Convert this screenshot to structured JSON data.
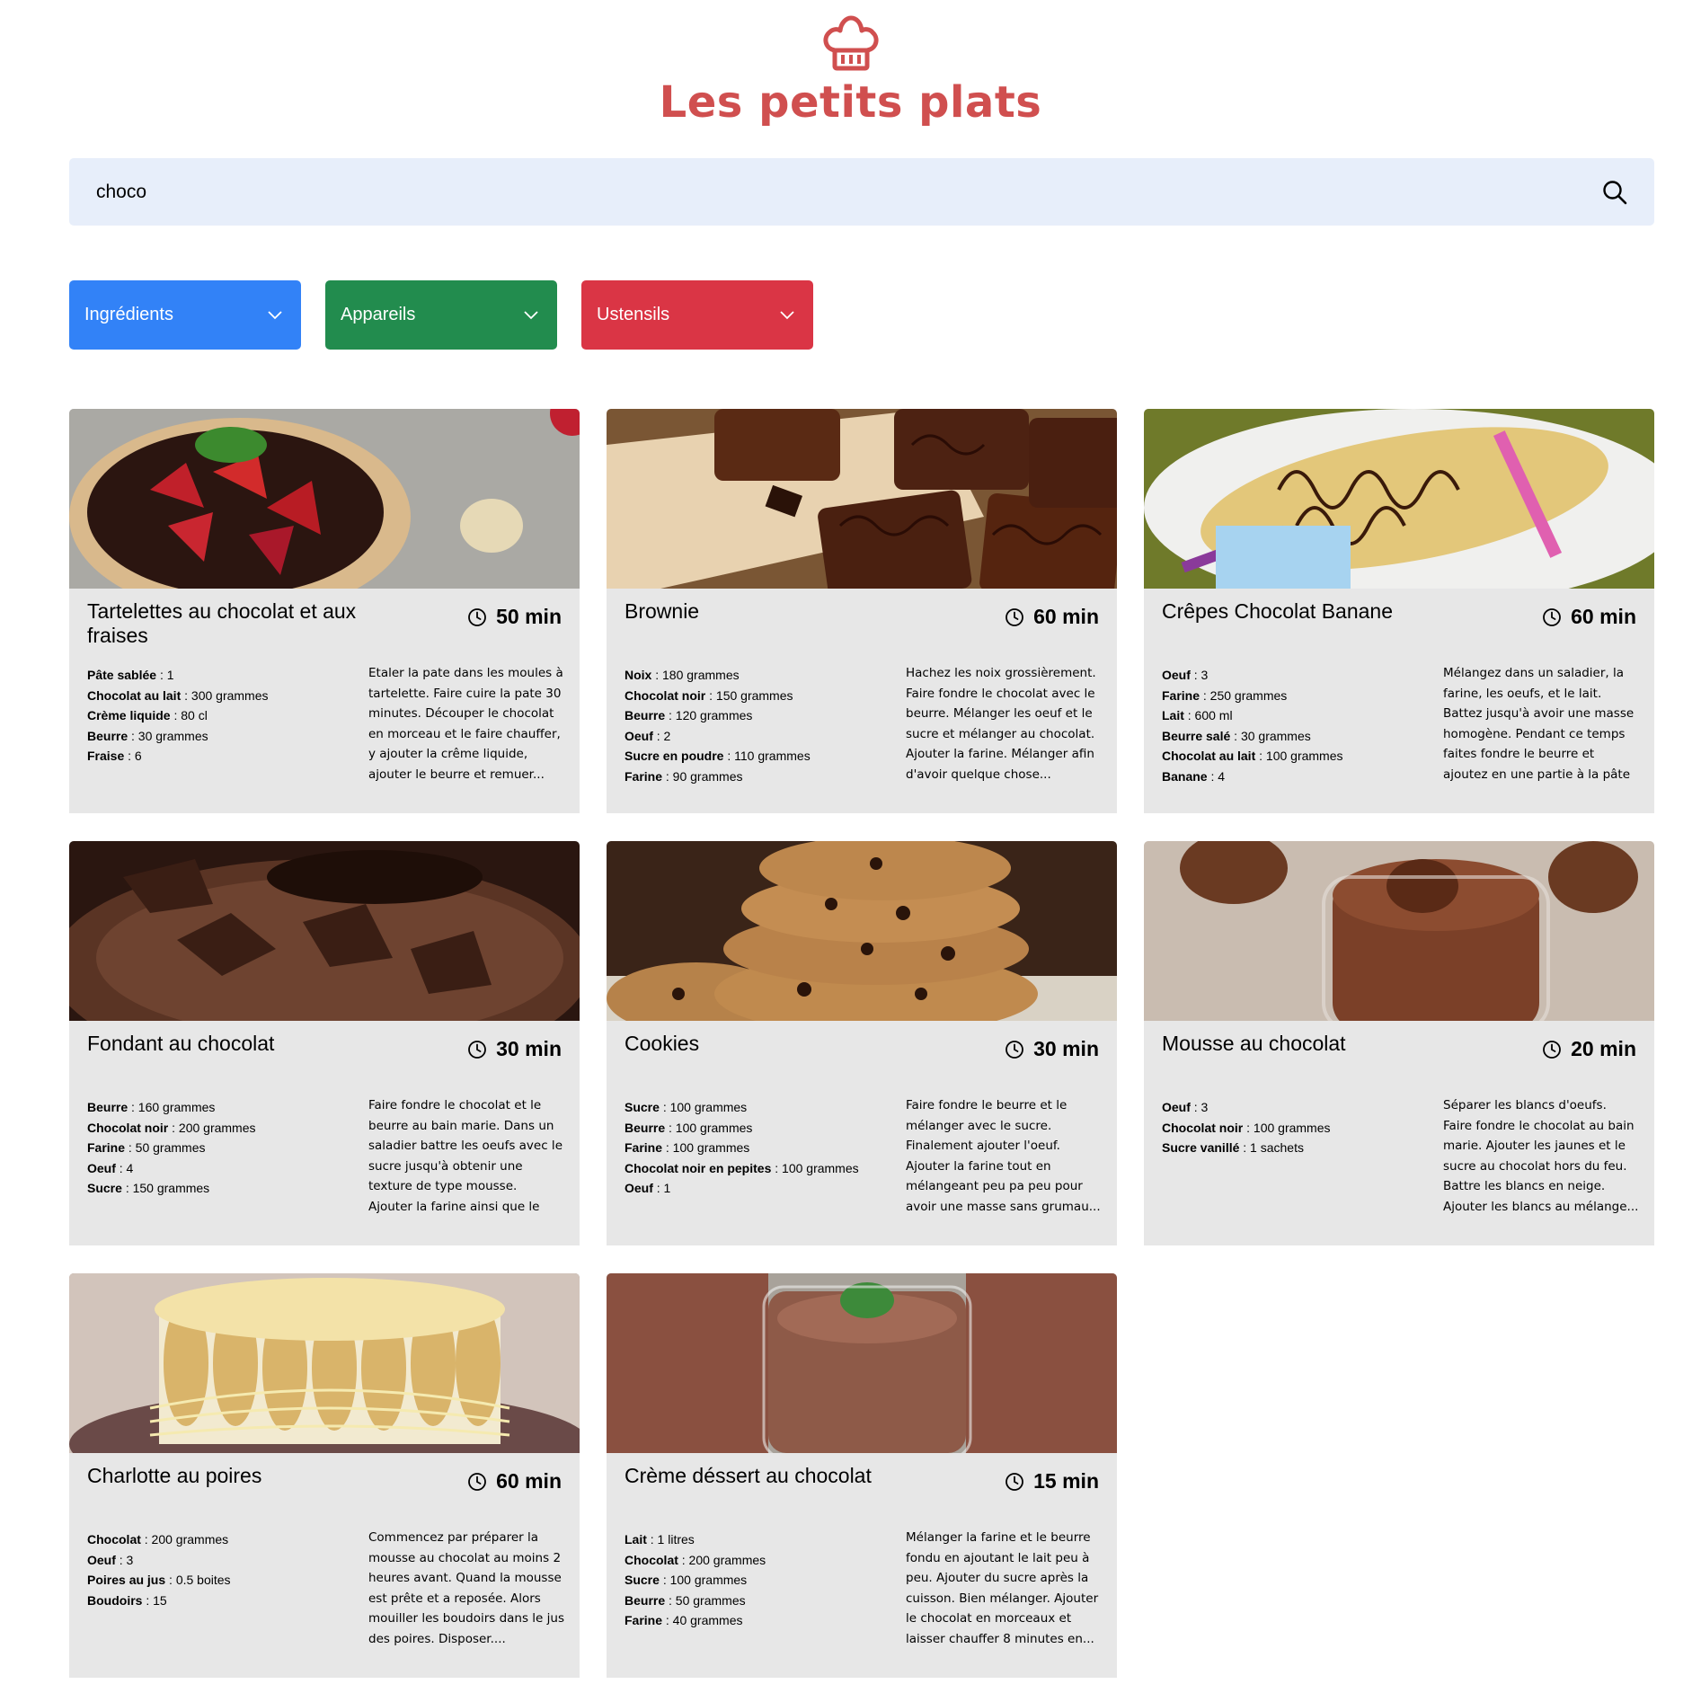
{
  "header": {
    "title": "Les petits plats",
    "logo_icon": "chef-hat-icon",
    "brand_color": "#D04F4F"
  },
  "search": {
    "value": "choco",
    "icon": "search-icon"
  },
  "filters": [
    {
      "label": "Ingrédients",
      "color": "#3282F7",
      "icon": "chevron-down-icon"
    },
    {
      "label": "Appareils",
      "color": "#228C4E",
      "icon": "chevron-down-icon"
    },
    {
      "label": "Ustensils",
      "color": "#DA3545",
      "icon": "chevron-down-icon"
    }
  ],
  "recipes": [
    {
      "name": "Tartelettes au chocolat et aux fraises",
      "time": "50 min",
      "image": "chocolate-strawberry-tart",
      "ingredients": [
        {
          "name": "Pâte sablée",
          "qty": ": 1"
        },
        {
          "name": "Chocolat au lait",
          "qty": ": 300 grammes"
        },
        {
          "name": "Crème liquide",
          "qty": ": 80 cl"
        },
        {
          "name": "Beurre",
          "qty": ": 30 grammes"
        },
        {
          "name": "Fraise",
          "qty": ": 6"
        }
      ],
      "description": "Etaler la pate dans les moules à tartelette. Faire cuire la pate 30 minutes. Découper le chocolat en morceau et le faire chauffer, y ajouter la crême liquide, ajouter le beurre et remuer..."
    },
    {
      "name": "Brownie",
      "time": "60 min",
      "image": "brownie",
      "ingredients": [
        {
          "name": "Noix",
          "qty": ": 180 grammes"
        },
        {
          "name": "Chocolat noir",
          "qty": ": 150 grammes"
        },
        {
          "name": "Beurre",
          "qty": ": 120 grammes"
        },
        {
          "name": "Oeuf",
          "qty": ": 2"
        },
        {
          "name": "Sucre en poudre",
          "qty": ": 110 grammes"
        },
        {
          "name": "Farine",
          "qty": ": 90 grammes"
        }
      ],
      "description": "Hachez les noix grossièrement. Faire fondre le chocolat avec le beurre. Mélanger les oeuf et le sucre et mélanger au chocolat. Ajouter la farine. Mélanger afin d'avoir quelque chose..."
    },
    {
      "name": "Crêpes Chocolat Banane",
      "time": "60 min",
      "image": "crepes",
      "ingredients": [
        {
          "name": "Oeuf",
          "qty": ": 3"
        },
        {
          "name": "Farine",
          "qty": ": 250 grammes"
        },
        {
          "name": "Lait",
          "qty": ": 600 ml"
        },
        {
          "name": "Beurre salé",
          "qty": ": 30 grammes"
        },
        {
          "name": "Chocolat au lait",
          "qty": ": 100 grammes"
        },
        {
          "name": "Banane",
          "qty": ": 4"
        }
      ],
      "description": "Mélangez dans un saladier, la farine, les oeufs, et le lait. Battez jusqu'à avoir une masse homogène. Pendant ce temps faites fondre le beurre et ajoutez en une partie à la pâte ..."
    },
    {
      "name": "Fondant au chocolat",
      "time": "30 min",
      "image": "fondant",
      "ingredients": [
        {
          "name": "Beurre",
          "qty": ": 160 grammes"
        },
        {
          "name": "Chocolat noir",
          "qty": ": 200 grammes"
        },
        {
          "name": "Farine",
          "qty": ": 50 grammes"
        },
        {
          "name": "Oeuf",
          "qty": ": 4"
        },
        {
          "name": "Sucre",
          "qty": ": 150 grammes"
        }
      ],
      "description": "Faire fondre le chocolat et le beurre au bain marie. Dans un saladier battre les oeufs avec le sucre jusqu'à obtenir une texture de type mousse. Ajouter la farine ainsi que le mélange..."
    },
    {
      "name": "Cookies",
      "time": "30 min",
      "image": "cookies",
      "ingredients": [
        {
          "name": "Sucre",
          "qty": ": 100 grammes"
        },
        {
          "name": "Beurre",
          "qty": ": 100 grammes"
        },
        {
          "name": "Farine",
          "qty": ": 100 grammes"
        },
        {
          "name": "Chocolat noir en pepites",
          "qty": ": 100 grammes"
        },
        {
          "name": "Oeuf",
          "qty": ": 1"
        }
      ],
      "description": "Faire fondre le beurre et le mélanger avec le sucre. Finalement ajouter l'oeuf. Ajouter la farine tout en mélangeant peu pa peu pour avoir une masse sans grumau..."
    },
    {
      "name": "Mousse au chocolat",
      "time": "20 min",
      "image": "mousse",
      "ingredients": [
        {
          "name": "Oeuf",
          "qty": ": 3"
        },
        {
          "name": "Chocolat noir",
          "qty": ": 100 grammes"
        },
        {
          "name": "Sucre vanillé",
          "qty": ": 1 sachets"
        }
      ],
      "description": "Séparer les blancs d'oeufs. Faire fondre le chocolat au bain marie. Ajouter les jaunes et le sucre au chocolat hors du feu. Battre les blancs en neige. Ajouter les blancs au mélange..."
    },
    {
      "name": "Charlotte au poires",
      "time": "60 min",
      "image": "charlotte",
      "ingredients": [
        {
          "name": "Chocolat",
          "qty": ": 200 grammes"
        },
        {
          "name": "Oeuf",
          "qty": ": 3"
        },
        {
          "name": "Poires au jus",
          "qty": ": 0.5 boites"
        },
        {
          "name": "Boudoirs",
          "qty": ": 15"
        }
      ],
      "description": "Commencez par préparer la mousse au chocolat au moins 2 heures avant. Quand la mousse est prête et a reposée. Alors mouiller les boudoirs dans le jus des poires. Disposer...."
    },
    {
      "name": "Crème déssert au chocolat",
      "time": "15 min",
      "image": "creme-dessert",
      "ingredients": [
        {
          "name": "Lait",
          "qty": ": 1 litres"
        },
        {
          "name": "Chocolat",
          "qty": ": 200 grammes"
        },
        {
          "name": "Sucre",
          "qty": ": 100 grammes"
        },
        {
          "name": "Beurre",
          "qty": ": 50 grammes"
        },
        {
          "name": "Farine",
          "qty": ": 40 grammes"
        }
      ],
      "description": "Mélanger la farine et le beurre fondu en ajoutant le lait peu à peu. Ajouter du sucre après la cuisson. Bien mélanger. Ajouter le chocolat en morceaux et laisser chauffer 8 minutes en..."
    }
  ]
}
